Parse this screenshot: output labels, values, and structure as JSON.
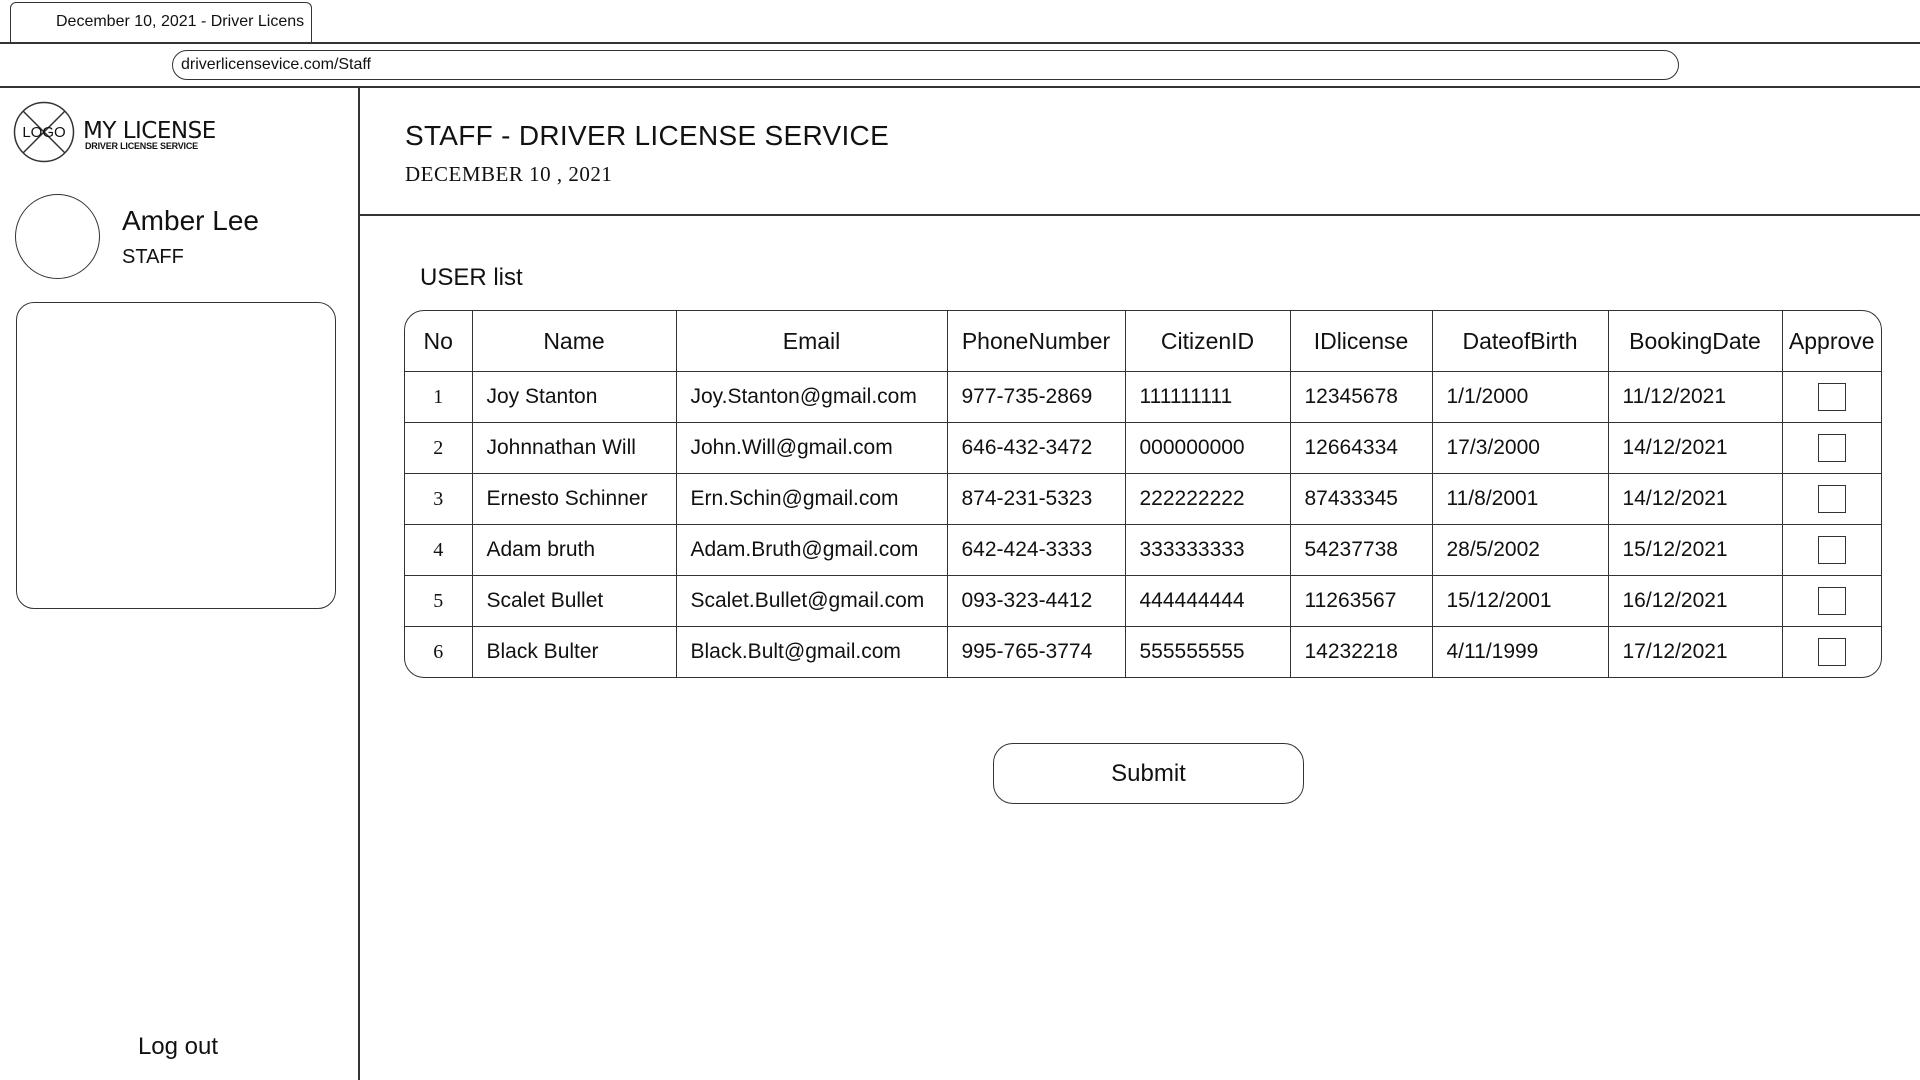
{
  "browser": {
    "tab_title": "December 10, 2021 - Driver Licens",
    "url": "driverlicensevice.com/Staff"
  },
  "sidebar": {
    "logo_mark": "LOGO",
    "logo_title": "MY LICENSE",
    "logo_subtitle": "DRIVER LICENSE SERVICE",
    "user_name": "Amber Lee",
    "user_role": "STAFF",
    "logout_label": "Log out"
  },
  "header": {
    "title": "STAFF -  DRIVER LICENSE SERVICE",
    "date": "DECEMBER 10 , 2021"
  },
  "main": {
    "list_title": "USER list",
    "columns": [
      "No",
      "Name",
      "Email",
      "PhoneNumber",
      "CitizenID",
      "IDlicense",
      "DateofBirth",
      "BookingDate",
      "Approve"
    ],
    "rows": [
      {
        "no": "1",
        "name": "Joy Stanton",
        "email": "Joy.Stanton@gmail.com",
        "phone": "977-735-2869",
        "citizen_id": "111111111",
        "id_license": "12345678",
        "dob": "1/1/2000",
        "booking": "11/12/2021",
        "approved": false
      },
      {
        "no": "2",
        "name": "Johnnathan Will",
        "email": "John.Will@gmail.com",
        "phone": "646-432-3472",
        "citizen_id": "000000000",
        "id_license": "12664334",
        "dob": "17/3/2000",
        "booking": "14/12/2021",
        "approved": false
      },
      {
        "no": "3",
        "name": "Ernesto Schinner",
        "email": "Ern.Schin@gmail.com",
        "phone": "874-231-5323",
        "citizen_id": "222222222",
        "id_license": "87433345",
        "dob": "11/8/2001",
        "booking": "14/12/2021",
        "approved": false
      },
      {
        "no": "4",
        "name": "Adam bruth",
        "email": "Adam.Bruth@gmail.com",
        "phone": "642-424-3333",
        "citizen_id": "333333333",
        "id_license": "54237738",
        "dob": "28/5/2002",
        "booking": "15/12/2021",
        "approved": false
      },
      {
        "no": "5",
        "name": "Scalet Bullet",
        "email": "Scalet.Bullet@gmail.com",
        "phone": "093-323-4412",
        "citizen_id": "444444444",
        "id_license": "11263567",
        "dob": "15/12/2001",
        "booking": "16/12/2021",
        "approved": false
      },
      {
        "no": "6",
        "name": "Black Bulter",
        "email": "Black.Bult@gmail.com",
        "phone": "995-765-3774",
        "citizen_id": "555555555",
        "id_license": "14232218",
        "dob": "4/11/1999",
        "booking": "17/12/2021",
        "approved": false
      }
    ],
    "submit_label": "Submit"
  }
}
